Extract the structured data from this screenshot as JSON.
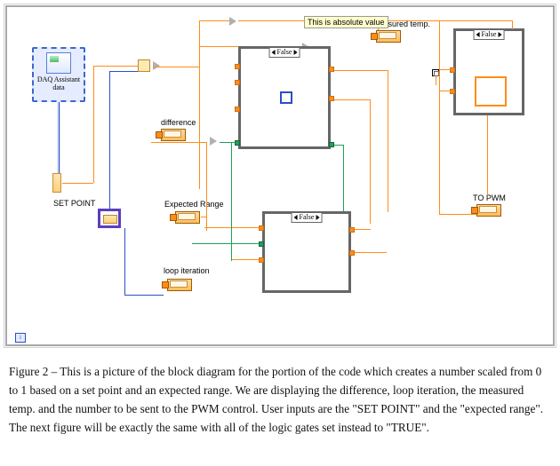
{
  "labels": {
    "daq_line1": "DAQ Assistant",
    "daq_line2": "data",
    "difference": "difference",
    "set_point": "SET POINT",
    "expected_range": "Expected Range",
    "loop_iteration": "loop iteration",
    "measured_temp": "Measured temp.",
    "to_pwm": "TO PWM",
    "tooltip_abs": "This is absolute value"
  },
  "case_selectors": {
    "case1": "False",
    "case2": "False",
    "case3": "False"
  },
  "iteration_terminal": "i",
  "caption": "Figure 2 – This is a picture of the block diagram for the portion of the code which creates a number scaled from 0 to 1 based on a set point and an expected range.  We are displaying the difference, loop iteration, the measured temp. and the number to be sent to the PWM control.  User inputs are the \"SET POINT\" and the \"expected range\".  The next figure will be exactly the same with all of the logic gates set instead to \"TRUE\"."
}
